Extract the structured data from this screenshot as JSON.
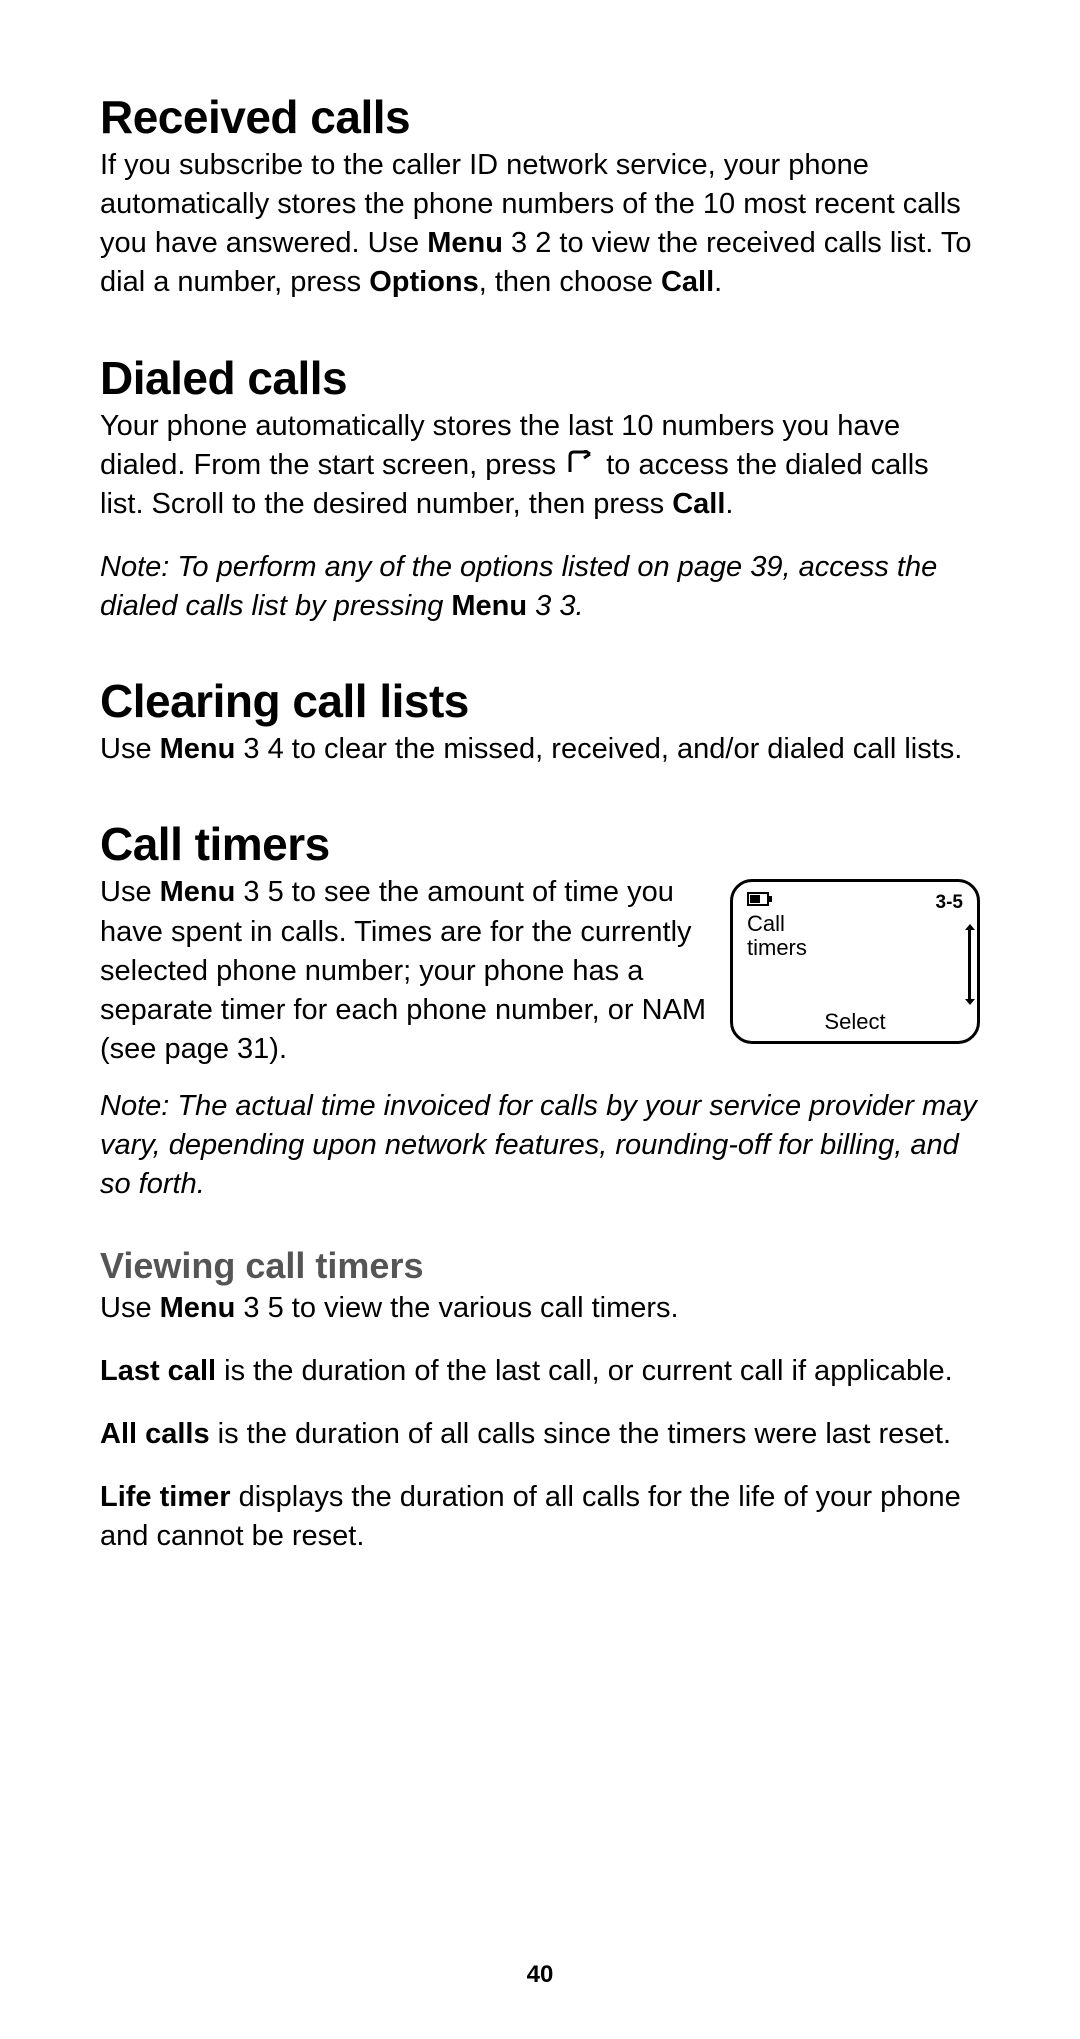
{
  "page_number": "40",
  "received": {
    "heading": "Received calls",
    "p1a": "If you subscribe to the caller ID network service, your phone automatically stores the phone numbers of the 10 most recent calls you have answered. Use ",
    "menu_lbl": "Menu",
    "p1b": " 3 2 to view the received calls list. To dial a number, press ",
    "options_lbl": "Options",
    "p1c": ", then choose ",
    "call_lbl": "Call",
    "p1d": "."
  },
  "dialed": {
    "heading": "Dialed calls",
    "p1a": "Your phone automatically stores the last 10 numbers you have dialed. From the start screen, press ",
    "p1b": " to access the dialed calls list. Scroll to the desired number, then press ",
    "call_lbl": "Call",
    "p1c": ".",
    "note_a": "Note:  To perform any of the options listed on page 39, access the dialed calls list by pressing ",
    "note_menu": "Menu",
    "note_b": " 3 3."
  },
  "clearing": {
    "heading": "Clearing call lists",
    "p_a": "Use ",
    "menu_lbl": "Menu",
    "p_b": " 3 4 to clear the missed, received, and/or dialed call lists."
  },
  "timers": {
    "heading": "Call timers",
    "p_a": "Use ",
    "menu_lbl": "Menu",
    "p_b": " 3 5 to see the amount of time you have spent in calls. Times are for the currently selected phone number; your phone has a separate timer for each phone number, or NAM (see page 31).",
    "screen": {
      "menu_num": "3-5",
      "title": "Call\ntimers",
      "select": "Select"
    },
    "note": "Note:  The actual time invoiced for calls by your service provider may vary, depending upon network features, rounding-off for billing, and so forth."
  },
  "viewing": {
    "heading": "Viewing call timers",
    "p1_a": "Use ",
    "menu_lbl": "Menu",
    "p1_b": " 3 5 to view the various call timers.",
    "last_lbl": "Last call",
    "last_txt": " is the duration of the last call, or current call if applicable.",
    "all_lbl": "All calls",
    "all_txt": " is the duration of all calls since the timers were last reset.",
    "life_lbl": "Life timer",
    "life_txt": " displays the duration of all calls for the life of your phone and cannot be reset."
  }
}
